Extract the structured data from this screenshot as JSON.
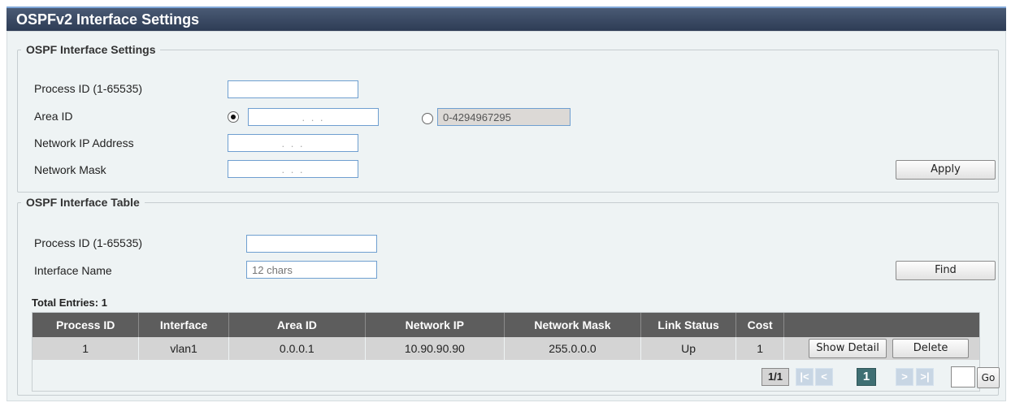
{
  "page": {
    "title": "OSPFv2 Interface Settings"
  },
  "settings": {
    "legend": "OSPF Interface Settings",
    "process_id_label": "Process ID (1-65535)",
    "process_id_value": "",
    "area_id_label": "Area ID",
    "area_id_ip_value": ". . .",
    "area_id_num_placeholder": "0-4294967295",
    "network_ip_label": "Network IP Address",
    "network_ip_value": ". . .",
    "network_mask_label": "Network Mask",
    "network_mask_value": ". . .",
    "apply_label": "Apply"
  },
  "table_section": {
    "legend": "OSPF Interface Table",
    "process_id_label": "Process ID (1-65535)",
    "process_id_value": "",
    "interface_name_label": "Interface Name",
    "interface_name_placeholder": "12 chars",
    "find_label": "Find",
    "total_entries": "Total Entries: 1",
    "columns": [
      "Process ID",
      "Interface",
      "Area ID",
      "Network IP",
      "Network Mask",
      "Link Status",
      "Cost",
      ""
    ],
    "rows": [
      {
        "process_id": "1",
        "interface": "vlan1",
        "area_id": "0.0.0.1",
        "network_ip": "10.90.90.90",
        "network_mask": "255.0.0.0",
        "link_status": "Up",
        "cost": "1",
        "show_detail_label": "Show Detail",
        "delete_label": "Delete"
      }
    ],
    "pager": {
      "page_info": "1/1",
      "first": "|<",
      "prev": "<",
      "current": "1",
      "next": ">",
      "last": ">|",
      "go_label": "Go",
      "go_value": ""
    }
  },
  "colors": {
    "title_bar": "#2e3c55",
    "table_header": "#5d5d5d",
    "row_bg": "#d4d4d4",
    "panel_bg": "#eef3f4",
    "current_page": "#3f6f73"
  }
}
